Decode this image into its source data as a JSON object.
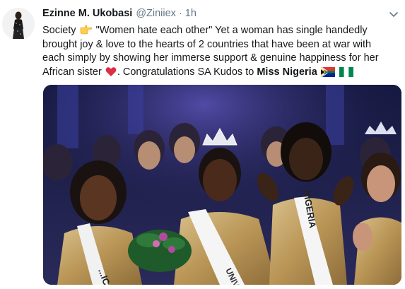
{
  "tweet": {
    "author_name": "Ezinne M. Ukobasi",
    "handle": "@Ziniiex",
    "separator": "·",
    "time": "1h",
    "lines": {
      "l1_a": "Society",
      "l1_b": "\"Women hate each other\" Yet a woman has single handedly",
      "l2": "brought joy & love to the hearts of 2 countries that have been at war with",
      "l3": "each simply by showing her immerse support & genuine happiness for her",
      "l4_a": "African sister",
      "l4_b": ". Congratulations SA Kudos to",
      "l4_c": "Miss Nigeria"
    },
    "emojis": [
      "pointing-right-hand",
      "red-heart",
      "flag-south-africa",
      "flag-nigeria"
    ],
    "sash_left": "...ICA",
    "sash_center": "UNIVE...",
    "sash_right": "NIGERIA"
  },
  "colors": {
    "text": "#14171a",
    "secondary": "#657786",
    "heart": "#e0245e",
    "nigeria_green": "#008751",
    "stage_blue": "#1b1e4a"
  }
}
